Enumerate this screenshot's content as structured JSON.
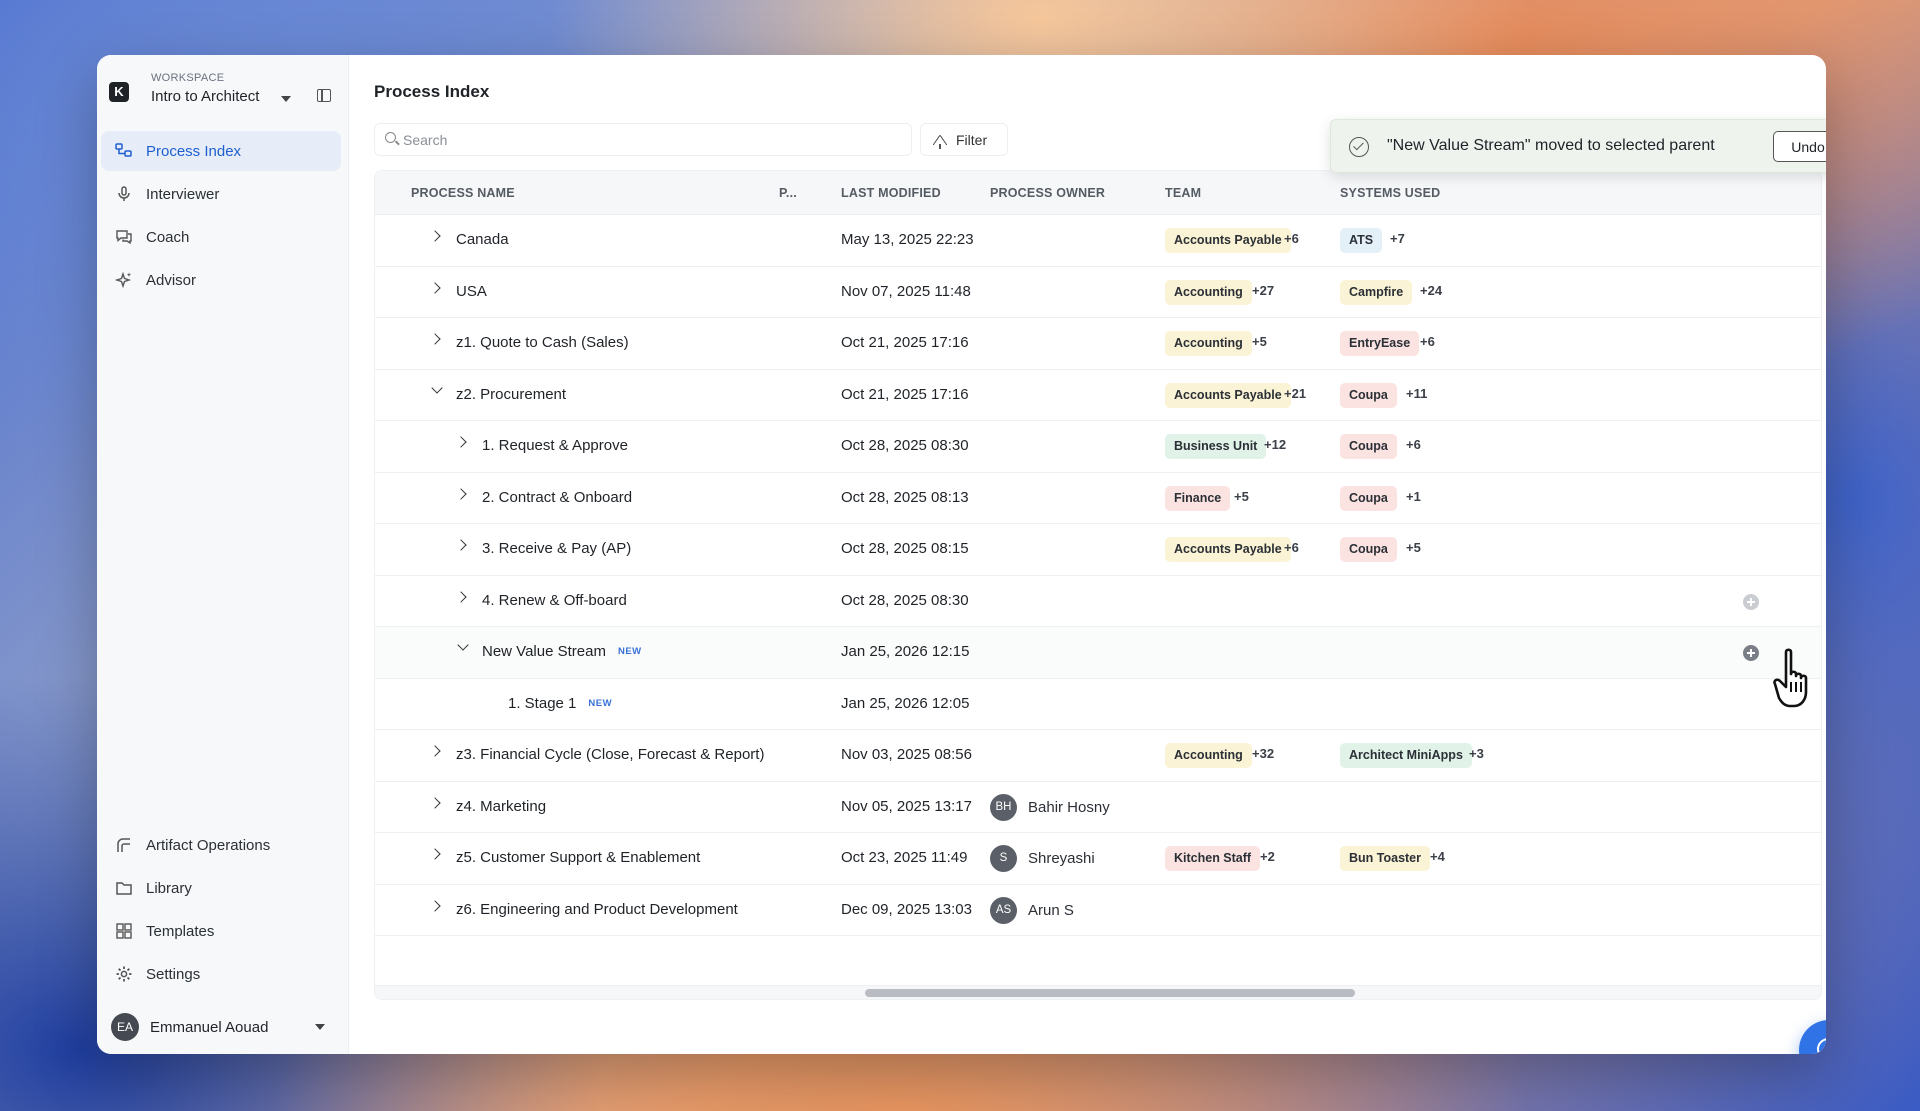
{
  "workspace": {
    "caption": "WORKSPACE",
    "name": "Intro to Architect",
    "logo_letter": "K"
  },
  "sidebar": {
    "top_items": [
      {
        "label": "Process Index",
        "icon": "process-tree-icon",
        "active": true
      },
      {
        "label": "Interviewer",
        "icon": "microphone-icon"
      },
      {
        "label": "Coach",
        "icon": "chat-bubbles-icon"
      },
      {
        "label": "Advisor",
        "icon": "sparkle-icon"
      }
    ],
    "bottom_items": [
      {
        "label": "Artifact Operations",
        "icon": "artifact-operations-icon"
      },
      {
        "label": "Library",
        "icon": "folder-icon"
      },
      {
        "label": "Templates",
        "icon": "templates-icon"
      },
      {
        "label": "Settings",
        "icon": "gear-icon"
      }
    ],
    "user": {
      "initials": "EA",
      "name": "Emmanuel Aouad"
    }
  },
  "main": {
    "title": "Process Index",
    "search_placeholder": "Search",
    "filter_label": "Filter"
  },
  "table": {
    "headers": [
      "PROCESS NAME",
      "P...",
      "LAST MODIFIED",
      "PROCESS OWNER",
      "TEAM",
      "SYSTEMS USED"
    ],
    "rows": [
      {
        "name": "Canada",
        "modified": "May 13, 2025 22:23",
        "team": "Accounts Payable",
        "team_more": "+6",
        "system": "ATS",
        "system_more": "+7"
      },
      {
        "name": "USA",
        "modified": "Nov 07, 2025 11:48",
        "team": "Accounting",
        "team_more": "+27",
        "system": "Campfire",
        "system_more": "+24"
      },
      {
        "name": "z1. Quote to Cash (Sales)",
        "modified": "Oct 21, 2025 17:16",
        "team": "Accounting",
        "team_more": "+5",
        "system": "EntryEase",
        "system_more": "+6"
      },
      {
        "name": "z2. Procurement",
        "modified": "Oct 21, 2025 17:16",
        "team": "Accounts Payable",
        "team_more": "+21",
        "system": "Coupa",
        "system_more": "+11"
      },
      {
        "name": "1. Request & Approve",
        "modified": "Oct 28, 2025 08:30",
        "team": "Business Unit",
        "team_more": "+12",
        "system": "Coupa",
        "system_more": "+6"
      },
      {
        "name": "2. Contract & Onboard",
        "modified": "Oct 28, 2025 08:13",
        "team": "Finance",
        "team_more": "+5",
        "system": "Coupa",
        "system_more": "+1"
      },
      {
        "name": "3. Receive & Pay (AP)",
        "modified": "Oct 28, 2025 08:15",
        "team": "Accounts Payable",
        "team_more": "+6",
        "system": "Coupa",
        "system_more": "+5"
      },
      {
        "name": "4. Renew & Off-board",
        "modified": "Oct 28, 2025 08:30"
      },
      {
        "name": "New Value Stream",
        "badge": "NEW",
        "modified": "Jan 25, 2026 12:15"
      },
      {
        "name": "1. Stage 1",
        "badge": "NEW",
        "modified": "Jan 25, 2026 12:05"
      },
      {
        "name": "z3. Financial Cycle (Close, Forecast & Report)",
        "modified": "Nov 03, 2025 08:56",
        "team": "Accounting",
        "team_more": "+32",
        "system": "Architect MiniApps",
        "system_more": "+3"
      },
      {
        "name": "z4. Marketing",
        "modified": "Nov 05, 2025 13:17",
        "owner_initials": "BH",
        "owner": "Bahir Hosny"
      },
      {
        "name": "z5. Customer Support & Enablement",
        "modified": "Oct 23, 2025 11:49",
        "owner_initials": "S",
        "owner": "Shreyashi",
        "team": "Kitchen Staff",
        "team_more": "+2",
        "system": "Bun Toaster",
        "system_more": "+4"
      },
      {
        "name": "z6. Engineering and Product Development",
        "modified": "Dec 09, 2025 13:03",
        "owner_initials": "AS",
        "owner": "Arun S"
      }
    ]
  },
  "toast": {
    "message": "\"New Value Stream\" moved to selected parent",
    "undo_label": "Undo"
  },
  "colors": {
    "accent": "#2f73e6",
    "tag_yellow": "#fbf3d5",
    "tag_blue": "#e3f0f7",
    "tag_red": "#fbe3e2",
    "tag_green": "#e1f2e8"
  }
}
